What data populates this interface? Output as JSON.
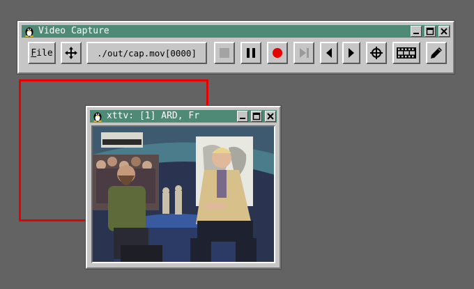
{
  "capture_window": {
    "title": "Video Capture",
    "file_menu_label": "File",
    "output_path": "./out/cap.mov[0000]",
    "buttons": [
      {
        "name": "move-button",
        "icon": "move-arrows-icon"
      },
      {
        "name": "stop-button",
        "icon": "stop-square-icon"
      },
      {
        "name": "pause-button",
        "icon": "pause-icon"
      },
      {
        "name": "record-button",
        "icon": "record-dot-icon"
      },
      {
        "name": "step-forward-button",
        "icon": "skip-forward-icon"
      },
      {
        "name": "prev-button",
        "icon": "triangle-left-icon"
      },
      {
        "name": "next-button",
        "icon": "triangle-right-icon"
      },
      {
        "name": "crosshair-button",
        "icon": "crosshair-icon"
      },
      {
        "name": "film-button",
        "icon": "filmstrip-icon"
      },
      {
        "name": "pen-button",
        "icon": "pencil-icon"
      }
    ]
  },
  "tv_window": {
    "title": "xttv: [1] ARD, Fr"
  },
  "colors": {
    "desktop": "#636363",
    "titlebar": "#4f8a76",
    "record": "#e60000",
    "selection_frame": "#e60000"
  }
}
